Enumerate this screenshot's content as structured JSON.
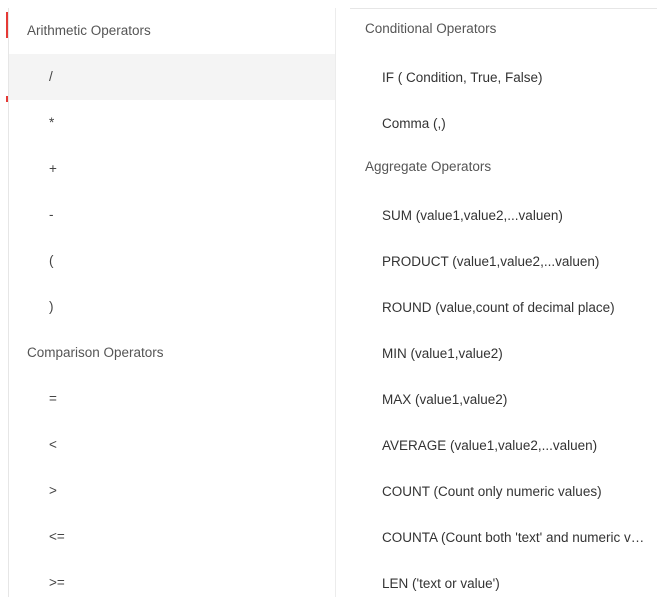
{
  "left_panel": {
    "arithmetic": {
      "title": "Arithmetic Operators",
      "items": [
        "/",
        "*",
        "+",
        "-",
        "(",
        ")"
      ]
    },
    "comparison": {
      "title": "Comparison Operators",
      "items": [
        "=",
        "<",
        ">",
        "<=",
        ">="
      ]
    }
  },
  "right_panel": {
    "conditional": {
      "title": "Conditional Operators",
      "items": [
        "IF ( Condition, True, False)",
        "Comma (,)"
      ]
    },
    "aggregate": {
      "title": "Aggregate Operators",
      "items": [
        "SUM (value1,value2,...valuen)",
        "PRODUCT (value1,value2,...valuen)",
        "ROUND (value,count of decimal place)",
        "MIN (value1,value2)",
        "MAX (value1,value2)",
        "AVERAGE (value1,value2,...valuen)",
        "COUNT (Count only numeric values)",
        "COUNTA (Count both 'text' and numeric values)",
        "LEN ('text or value')"
      ]
    }
  },
  "colors": {
    "selected_row": "#f4f4f4",
    "marker": "#e53935",
    "divider": "#ececec"
  }
}
